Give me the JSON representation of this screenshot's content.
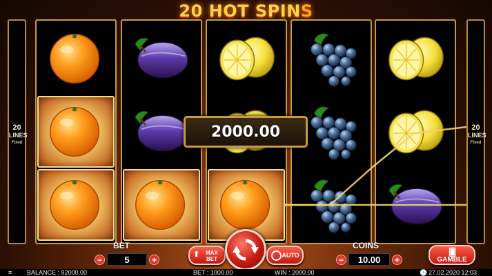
{
  "game": {
    "title_main": "20 HOT SPIN",
    "title_tail": "S"
  },
  "lines": {
    "count": "20",
    "label": "LINES",
    "mode": "Fixed"
  },
  "reels": [
    [
      "orange",
      "orange",
      "orange"
    ],
    [
      "plum",
      "plum",
      "orange"
    ],
    [
      "lemon",
      "lemon",
      "orange"
    ],
    [
      "grapes",
      "grapes",
      "grapes"
    ],
    [
      "lemon",
      "lemon",
      "plum"
    ]
  ],
  "winning_cells": [
    [
      0,
      1
    ],
    [
      0,
      2
    ],
    [
      1,
      2
    ],
    [
      2,
      2
    ]
  ],
  "win_display": "2000.00",
  "bet": {
    "label": "BET",
    "value": "5"
  },
  "coins": {
    "label": "COINS",
    "value": "10.00"
  },
  "buttons": {
    "max_bet": [
      "MAX",
      "BET"
    ],
    "auto": "AUTO",
    "gamble": "GAMBLE",
    "minus": "−",
    "plus": "+"
  },
  "status": {
    "balance": "BALANCE : 92000.00",
    "bet": "BET : 1000.00",
    "win": "WIN : 2000.00",
    "datetime": "27.02.2020 12:03",
    "clock_icon": "clock-icon"
  },
  "colors": {
    "accent": "#ffd24a",
    "frame": "#c79a45",
    "button_red": "#c01810",
    "payline": "#f2d36a"
  }
}
